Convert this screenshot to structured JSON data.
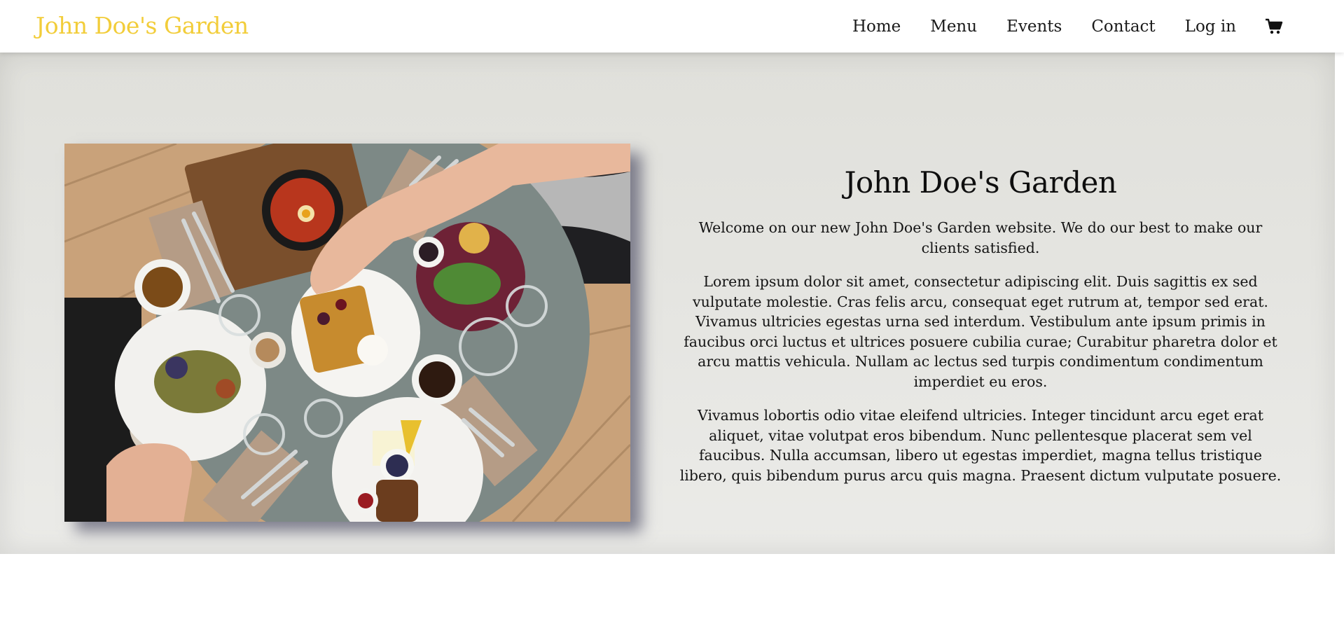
{
  "brand": {
    "title": "John Doe's Garden",
    "color": "#f2cd3a"
  },
  "nav": {
    "items": [
      {
        "label": "Home"
      },
      {
        "label": "Menu"
      },
      {
        "label": "Events"
      },
      {
        "label": "Contact"
      },
      {
        "label": "Log in"
      }
    ],
    "cart_icon": "shopping-cart-icon"
  },
  "hero": {
    "image": "overhead-brunch-table-photo",
    "title": "John Doe's Garden",
    "paragraphs": [
      "Welcome on our new John Doe's Garden website. We do our best to make our clients satisfied.",
      "Lorem ipsum dolor sit amet, consectetur adipiscing elit. Duis sagittis ex sed vulputate molestie. Cras felis arcu, consequat eget rutrum at, tempor sed erat. Vivamus ultricies egestas urna sed interdum. Vestibulum ante ipsum primis in faucibus orci luctus et ultrices posuere cubilia curae; Curabitur pharetra dolor et arcu mattis vehicula. Nullam ac lectus sed turpis condimentum condimentum imperdiet eu eros.",
      "Vivamus lobortis odio vitae eleifend ultricies. Integer tincidunt arcu eget erat aliquet, vitae volutpat eros bibendum. Nunc pellentesque placerat sem vel faucibus. Nulla accumsan, libero ut egestas imperdiet, magna tellus tristique libero, quis bibendum purus arcu quis magna. Praesent dictum vulputate posuere."
    ]
  }
}
